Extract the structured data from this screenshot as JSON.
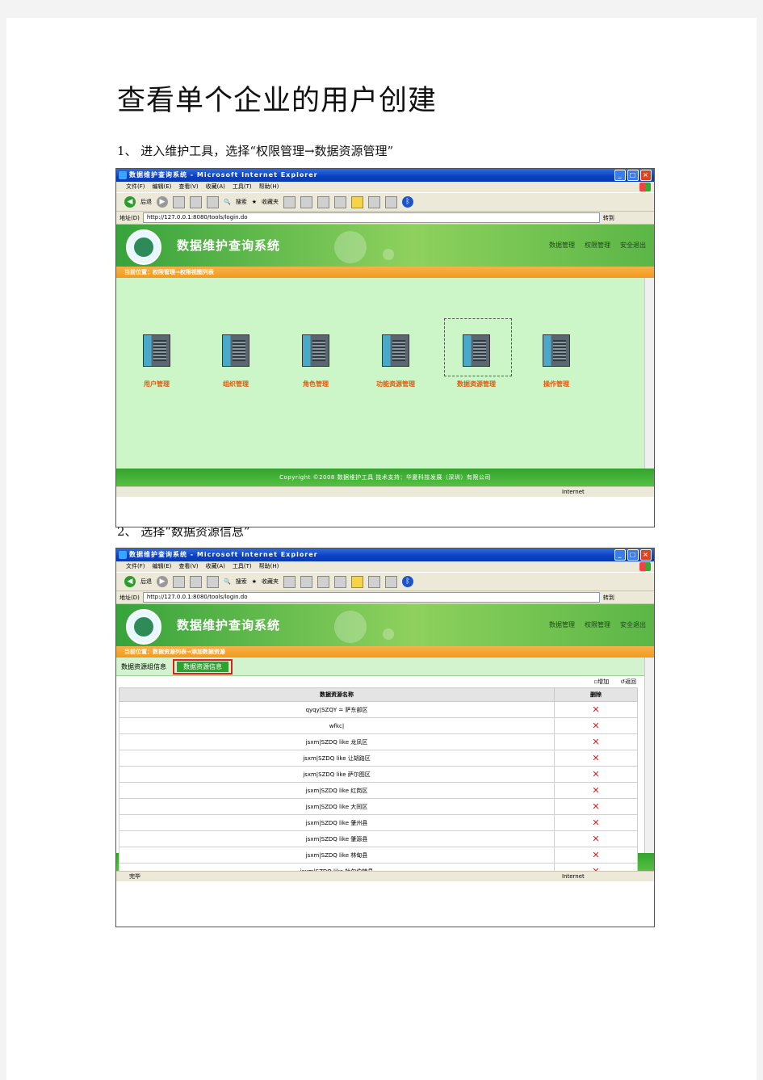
{
  "doc": {
    "title": "查看单个企业的用户创建",
    "step1": "1、 进入维护工具，选择“权限管理→数据资源管理”",
    "step2": "2、 选择“数据资源信息”"
  },
  "browser": {
    "window_title": "数据维护查询系统 - Microsoft Internet Explorer",
    "menus": [
      "文件(F)",
      "编辑(E)",
      "查看(V)",
      "收藏(A)",
      "工具(T)",
      "帮助(H)"
    ],
    "back_label": "后退",
    "search_label": "搜索",
    "favorites_label": "收藏夹",
    "address_label": "地址(D)",
    "address_value": "http://127.0.0.1:8080/tools/login.do",
    "go_label": "转到",
    "status_done": "完毕",
    "zone": "Internet"
  },
  "app": {
    "system_title": "数据维护查询系统",
    "nav": [
      "数据管理",
      "权限管理",
      "安全退出"
    ],
    "footer": "Copyright ©2008 数据维护工具    技术支持：华夏科技发展（深圳）有限公司"
  },
  "screen1": {
    "location": "当前位置：权限管理→权限视图列表",
    "modules": [
      "用户管理",
      "组织管理",
      "角色管理",
      "功能资源管理",
      "数据资源管理",
      "操作管理"
    ]
  },
  "screen2": {
    "location": "当前位置：数据资源列表→添加数据资源",
    "tab_group": "数据资源组信息",
    "tab_active": "数据资源信息",
    "add_label": "增加",
    "back_label": "返回",
    "col_name": "数据资源名称",
    "col_delete": "删除",
    "rows": [
      "qyqy|SZQY = 萨东部区",
      "wfkc|",
      "jsxm|SZDQ like 龙凤区",
      "jsxm|SZDQ like 让胡路区",
      "jsxm|SZDQ like 萨尔图区",
      "jsxm|SZDQ like 红岗区",
      "jsxm|SZDQ like 大同区",
      "jsxm|SZDQ like 肇州县",
      "jsxm|SZDQ like 肇源县",
      "jsxm|SZDQ like 林甸县",
      "jsxm|SZDQ like 杜尔伯特县"
    ]
  }
}
